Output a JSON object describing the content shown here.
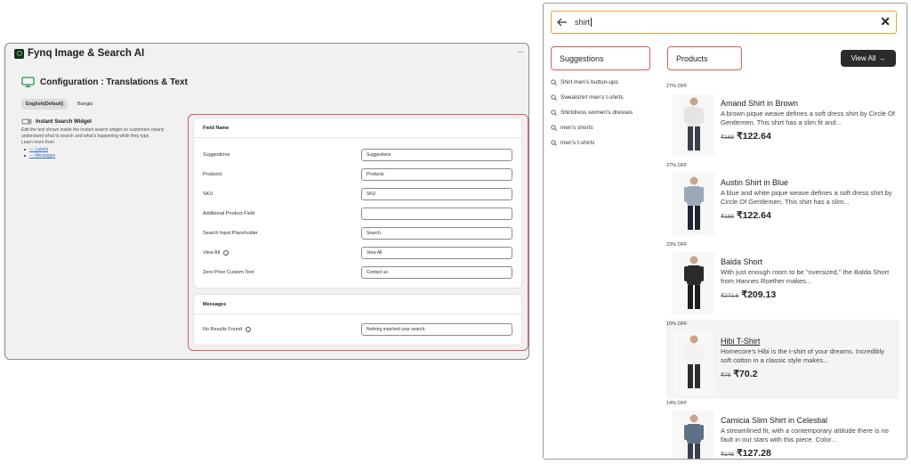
{
  "admin": {
    "app_title": "Fynq Image & Search AI",
    "more_label": "···",
    "page_title": "Configuration : Translations & Text",
    "lang_tabs": [
      "English(Default)",
      "Bangla"
    ],
    "widget": {
      "title": "Instant Search Widget",
      "description": "Edit the text shown inside the instant search widget so customers clearly understand what to search and what's happening while they type.",
      "learn_more": "Learn more from",
      "links": [
        "— Labels",
        "— Messages"
      ]
    },
    "fields_card": {
      "header": "Field Name",
      "rows": [
        {
          "label": "Suggestions",
          "value": "Suggestions"
        },
        {
          "label": "Products",
          "value": "Products"
        },
        {
          "label": "SKU",
          "value": "SKU"
        },
        {
          "label": "Additional Product Field",
          "value": ""
        },
        {
          "label": "Search Input Placeholder",
          "value": "Search"
        },
        {
          "label": "View All",
          "value": "View All"
        },
        {
          "label": "Zero Price Custom Text",
          "value": "Contact us"
        }
      ]
    },
    "messages_card": {
      "header": "Messages",
      "rows": [
        {
          "label": "No Results Found",
          "value": "Nothing matched your search."
        }
      ]
    },
    "info_glyph": "i"
  },
  "store": {
    "search_value": "shirt",
    "close_glyph": "✕",
    "suggestions_heading": "Suggestions",
    "products_heading": "Products",
    "view_all_label": "View All",
    "view_all_arrow": "→",
    "suggestions": [
      "Shirt men's button-ups",
      "Sweatshirt men's t-shirts",
      "Shirtdress women's dresses",
      "men's shorts",
      "men's t-shirts"
    ],
    "products": [
      {
        "discount": "27% OFF",
        "name": "Amand Shirt in Brown",
        "description": "A brown pique weave defines a soft dress shirt by Circle Of Gentlemen. This shirt has a slim fit and...",
        "old_price": "₹168",
        "price": "₹122.64",
        "top_color": "#e4e4e4",
        "bottom_color": "#3a3f4a"
      },
      {
        "discount": "27% OFF",
        "name": "Austin Shirt in Blue",
        "description": "A blue and white pique weave defines a soft dress shirt by Circle Of Gentlemen. This shirt has a slim...",
        "old_price": "₹168",
        "price": "₹122.64",
        "top_color": "#9aa8b8",
        "bottom_color": "#1f2430"
      },
      {
        "discount": "23% OFF",
        "name": "Balda Short",
        "description": "With just enough room to be \"oversized,\" the Balda Short from Hannes Roether makes...",
        "old_price": "₹271.6",
        "price": "₹209.13",
        "top_color": "#2a2a2a",
        "bottom_color": "#1c1c1c"
      },
      {
        "discount": "10% OFF",
        "name": "Hibi T-Shirt",
        "description": "Homecore's Hibi is the t-shirt of your dreams. Incredibly soft cotton in a classic style makes...",
        "old_price": "₹78",
        "price": "₹70.2",
        "top_color": "#f2f2f2",
        "bottom_color": "#2d2d2d"
      },
      {
        "discount": "14% OFF",
        "name": "Camicia Slim Shirt in Celestial",
        "description": "A streamlined fit, with a contemporary attitude there is no fault in our stars with this piece. Color...",
        "old_price": "₹148",
        "price": "₹127.28",
        "top_color": "#5f7186",
        "bottom_color": "#3a4050"
      }
    ]
  },
  "colors": {
    "highlight_border": "#e0595a",
    "search_border": "#e8a23a",
    "button_dark": "#2b2b2b",
    "brand_green": "#37d06a"
  }
}
